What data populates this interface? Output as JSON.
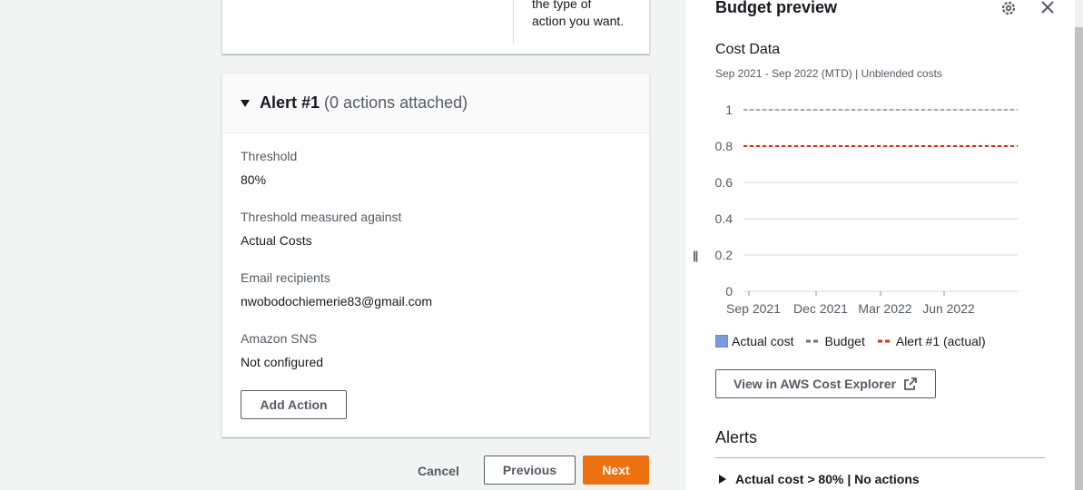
{
  "top_card": {
    "help_text_line1": "the type of",
    "help_text_line2": "action you want."
  },
  "alert": {
    "title": "Alert #1",
    "subtitle": "(0 actions attached)",
    "fields": [
      {
        "label": "Threshold",
        "value": "80%"
      },
      {
        "label": "Threshold measured against",
        "value": "Actual Costs"
      },
      {
        "label": "Email recipients",
        "value": "nwobodochiemerie83@gmail.com"
      },
      {
        "label": "Amazon SNS",
        "value": "Not configured"
      }
    ],
    "add_action_label": "Add Action"
  },
  "footer": {
    "cancel_label": "Cancel",
    "previous_label": "Previous",
    "next_label": "Next"
  },
  "panel": {
    "title": "Budget preview",
    "settings_icon": "gear-icon",
    "close_icon": "close-icon",
    "cost_title": "Cost Data",
    "cost_subtitle": "Sep 2021 - Sep 2022 (MTD) | Unblended costs",
    "pause_icon": "pause-icon",
    "legend": [
      {
        "name": "Actual cost",
        "color": "#7c9ae1"
      },
      {
        "name": "Budget",
        "color": "#687078"
      },
      {
        "name": "Alert #1 (actual)",
        "color": "#d13212"
      }
    ],
    "explorer_button_label": "View in AWS Cost Explorer",
    "alerts_title": "Alerts",
    "alert_summary": "Actual cost > 80% | No actions"
  },
  "chart_data": {
    "type": "line",
    "title": "Cost Data",
    "x_tick_labels": [
      "Sep 2021",
      "Dec 2021",
      "Mar 2022",
      "Jun 2022"
    ],
    "y_ticks": [
      0,
      0.2,
      0.4,
      0.6,
      0.8,
      1
    ],
    "ylim": [
      0,
      1
    ],
    "series": [
      {
        "name": "Actual cost",
        "values": []
      },
      {
        "name": "Budget",
        "constant": 1
      },
      {
        "name": "Alert #1 (actual)",
        "constant": 0.8
      }
    ],
    "grid": true,
    "legend": "bottom"
  }
}
